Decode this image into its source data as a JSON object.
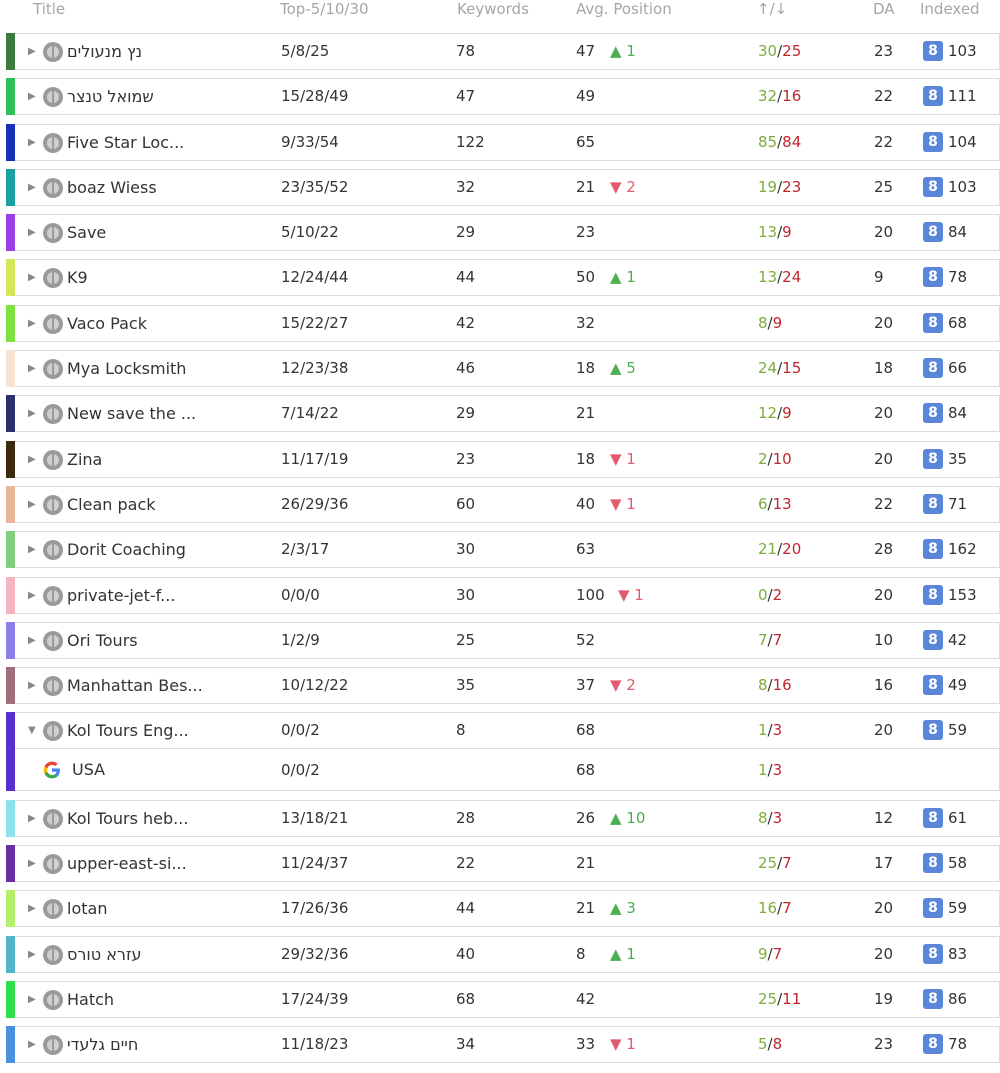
{
  "header": {
    "title": "Title",
    "top": "Top-5/10/30",
    "keywords": "Keywords",
    "avg_position": "Avg. Position",
    "updown": "↑/↓",
    "da": "DA",
    "indexed": "Indexed"
  },
  "indexed_icon_letter": "8",
  "rows": [
    {
      "color": "#3d7a3d",
      "title": "נץ מנעולים",
      "top": "5/8/25",
      "kw": "78",
      "pos": "47",
      "chg_dir": "up",
      "chg": "1",
      "up": "30",
      "down": "25",
      "da": "23",
      "idx": "103"
    },
    {
      "color": "#2fbf5a",
      "title": "שמואל טנצר",
      "top": "15/28/49",
      "kw": "47",
      "pos": "49",
      "chg_dir": "",
      "chg": "",
      "up": "32",
      "down": "16",
      "da": "22",
      "idx": "111"
    },
    {
      "color": "#1a2fb8",
      "title": "Five Star Loc...",
      "top": "9/33/54",
      "kw": "122",
      "pos": "65",
      "chg_dir": "",
      "chg": "",
      "up": "85",
      "down": "84",
      "da": "22",
      "idx": "104"
    },
    {
      "color": "#1aa0a0",
      "title": "boaz Wiess",
      "top": "23/35/52",
      "kw": "32",
      "pos": "21",
      "chg_dir": "down",
      "chg": "2",
      "up": "19",
      "down": "23",
      "da": "25",
      "idx": "103"
    },
    {
      "color": "#9b3ee6",
      "title": "Save",
      "top": "5/10/22",
      "kw": "29",
      "pos": "23",
      "chg_dir": "",
      "chg": "",
      "up": "13",
      "down": "9",
      "da": "20",
      "idx": "84"
    },
    {
      "color": "#d4e65a",
      "title": "K9",
      "top": "12/24/44",
      "kw": "44",
      "pos": "50",
      "chg_dir": "up",
      "chg": "1",
      "up": "13",
      "down": "24",
      "da": "9",
      "idx": "78"
    },
    {
      "color": "#7de043",
      "title": "Vaco Pack",
      "top": "15/22/27",
      "kw": "42",
      "pos": "32",
      "chg_dir": "",
      "chg": "",
      "up": "8",
      "down": "9",
      "da": "20",
      "idx": "68"
    },
    {
      "color": "#f5e3d6",
      "title": "Mya Locksmith",
      "top": "12/23/38",
      "kw": "46",
      "pos": "18",
      "chg_dir": "up",
      "chg": "5",
      "up": "24",
      "down": "15",
      "da": "18",
      "idx": "66"
    },
    {
      "color": "#2b2f6e",
      "title": "New save the ...",
      "top": "7/14/22",
      "kw": "29",
      "pos": "21",
      "chg_dir": "",
      "chg": "",
      "up": "12",
      "down": "9",
      "da": "20",
      "idx": "84"
    },
    {
      "color": "#3b2a0e",
      "title": "Zina",
      "top": "11/17/19",
      "kw": "23",
      "pos": "18",
      "chg_dir": "down",
      "chg": "1",
      "up": "2",
      "down": "10",
      "da": "20",
      "idx": "35"
    },
    {
      "color": "#e8b598",
      "title": "Clean pack",
      "top": "26/29/36",
      "kw": "60",
      "pos": "40",
      "chg_dir": "down",
      "chg": "1",
      "up": "6",
      "down": "13",
      "da": "22",
      "idx": "71"
    },
    {
      "color": "#7fcf7f",
      "title": "Dorit Coaching",
      "top": "2/3/17",
      "kw": "30",
      "pos": "63",
      "chg_dir": "",
      "chg": "",
      "up": "21",
      "down": "20",
      "da": "28",
      "idx": "162"
    },
    {
      "color": "#f5b5c0",
      "title": "private-jet-f...",
      "top": "0/0/0",
      "kw": "30",
      "pos": "100",
      "chg_dir": "down",
      "chg": "1",
      "up": "0",
      "down": "2",
      "da": "20",
      "idx": "153"
    },
    {
      "color": "#8a7fe6",
      "title": "Ori Tours",
      "top": "1/2/9",
      "kw": "25",
      "pos": "52",
      "chg_dir": "",
      "chg": "",
      "up": "7",
      "down": "7",
      "da": "10",
      "idx": "42"
    },
    {
      "color": "#a0707a",
      "title": "Manhattan Bes...",
      "top": "10/12/22",
      "kw": "35",
      "pos": "37",
      "chg_dir": "down",
      "chg": "2",
      "up": "8",
      "down": "16",
      "da": "16",
      "idx": "49"
    },
    {
      "color": "#5a2fd0",
      "title": "Kol Tours Eng...",
      "top": "0/0/2",
      "kw": "8",
      "pos": "68",
      "chg_dir": "",
      "chg": "",
      "up": "1",
      "down": "3",
      "da": "20",
      "idx": "59",
      "expanded": true,
      "sub": {
        "title": "USA",
        "top": "0/0/2",
        "pos": "68",
        "up": "1",
        "down": "3"
      }
    },
    {
      "color": "#8fe0ef",
      "title": "Kol Tours heb...",
      "top": "13/18/21",
      "kw": "28",
      "pos": "26",
      "chg_dir": "up",
      "chg": "10",
      "up": "8",
      "down": "3",
      "da": "12",
      "idx": "61"
    },
    {
      "color": "#6a2fa0",
      "title": "upper-east-si...",
      "top": "11/24/37",
      "kw": "22",
      "pos": "21",
      "chg_dir": "",
      "chg": "",
      "up": "25",
      "down": "7",
      "da": "17",
      "idx": "58"
    },
    {
      "color": "#b5ef6a",
      "title": "lotan",
      "top": "17/26/36",
      "kw": "44",
      "pos": "21",
      "chg_dir": "up",
      "chg": "3",
      "up": "16",
      "down": "7",
      "da": "20",
      "idx": "59"
    },
    {
      "color": "#4fb5c8",
      "title": "עזרא טורס",
      "top": "29/32/36",
      "kw": "40",
      "pos": "8",
      "chg_dir": "up",
      "chg": "1",
      "up": "9",
      "down": "7",
      "da": "20",
      "idx": "83"
    },
    {
      "color": "#2fe04a",
      "title": "Hatch",
      "top": "17/24/39",
      "kw": "68",
      "pos": "42",
      "chg_dir": "",
      "chg": "",
      "up": "25",
      "down": "11",
      "da": "19",
      "idx": "86"
    },
    {
      "color": "#4a8fe0",
      "title": "חיים גלעדי",
      "top": "11/18/23",
      "kw": "34",
      "pos": "33",
      "chg_dir": "down",
      "chg": "1",
      "up": "5",
      "down": "8",
      "da": "23",
      "idx": "78"
    }
  ]
}
